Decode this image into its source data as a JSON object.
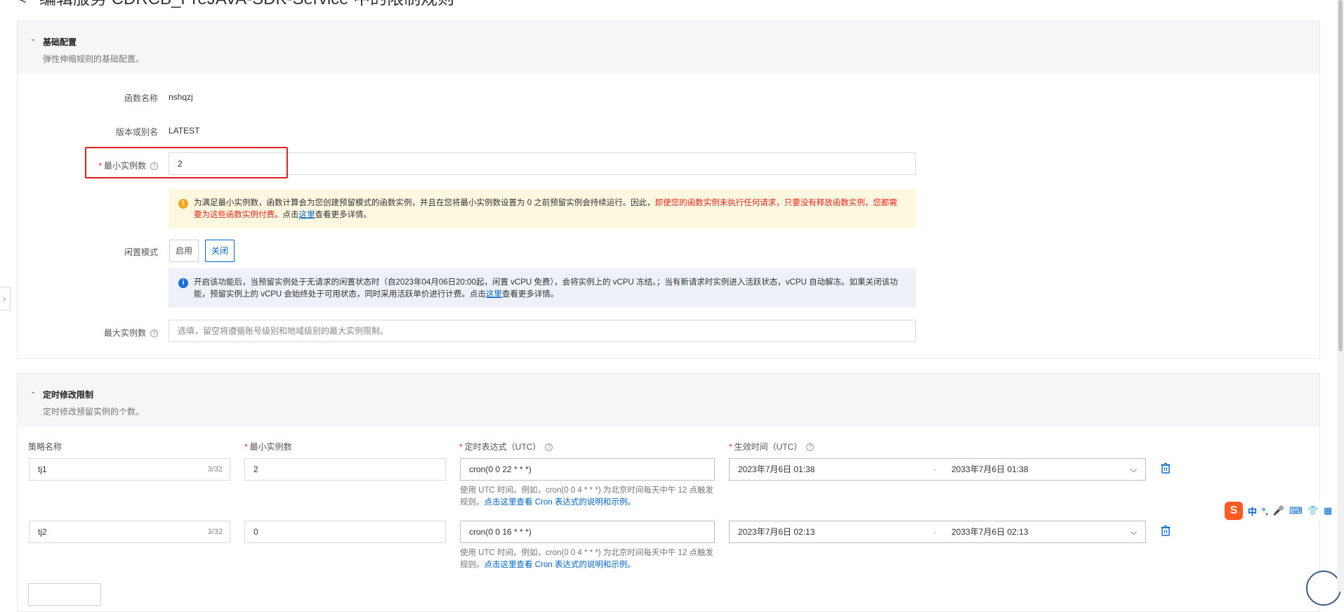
{
  "header": {
    "back_icon": "chevron-left-icon",
    "title": "编辑服务 CDRCB_PreJAVA-SDK-Service 中的限制规则"
  },
  "basic": {
    "title": "基础配置",
    "desc": "弹性伸缩规则的基础配置。",
    "fn_name_label": "函数名称",
    "fn_name_value": "nshqzj",
    "version_label": "版本或别名",
    "version_value": "LATEST",
    "min_label": "最小实例数",
    "min_value": "2",
    "warn_part1": "为满足最小实例数，函数计算会为您创建预留模式的函数实例，并且在您将最小实例数设置为 0 之前预留实例会持续运行。因此，",
    "warn_red": "即便您的函数实例未执行任何请求，只要没有释放函数实例，您都需要为这些函数实例付费",
    "warn_part2": "。点击",
    "warn_link": "这里",
    "warn_part3": "查看更多详情。",
    "idle_label": "闲置模式",
    "idle_on": "启用",
    "idle_off": "关闭",
    "info_part1": "开启该功能后，当预留实例处于无请求的闲置状态时（自2023年04月06日20:00起，闲置 vCPU 免费），会将实例上的 vCPU 冻结。；当有新请求时实例进入活跃状态，vCPU 自动解冻。如果关闭该功能，预留实例上的 vCPU 会始终处于可用状态，同时采用活跃单价进行计费。点击",
    "info_link": "这里",
    "info_part2": "查看更多详情。",
    "max_label": "最大实例数",
    "max_placeholder": "选填，留空将遵循账号级别和地域级别的最大实例限制。"
  },
  "scheduled": {
    "title": "定时修改限制",
    "desc": "定时修改预留实例的个数。",
    "col_name": "策略名称",
    "col_min": "最小实例数",
    "col_cron": "定时表达式（UTC）",
    "col_time": "生效时间（UTC）",
    "hint_prefix": "使用 UTC 时间。例如，cron(0 0 4 * * *) 为北京时间每天中午 12 点触发规则。",
    "hint_link": "点击这里查看 Cron 表达式的说明和示例。",
    "rows": [
      {
        "name": "tj1",
        "counter": "3/32",
        "min": "2",
        "cron": "cron(0 0 22 * * *)",
        "start": "2023年7月6日 01:38",
        "sep": "-",
        "end": "2033年7月6日 01:38"
      },
      {
        "name": "tj2",
        "counter": "3/32",
        "min": "0",
        "cron": "cron(0 0 16 * * *)",
        "start": "2023年7月6日 02:13",
        "sep": "-",
        "end": "2033年7月6日 02:13"
      }
    ]
  },
  "ime_toolbar": {
    "logo": "S",
    "lang": "中",
    "punct": "°,",
    "icons": [
      "mic-icon",
      "keyboard-icon",
      "shirt-icon",
      "grid-icon"
    ]
  }
}
